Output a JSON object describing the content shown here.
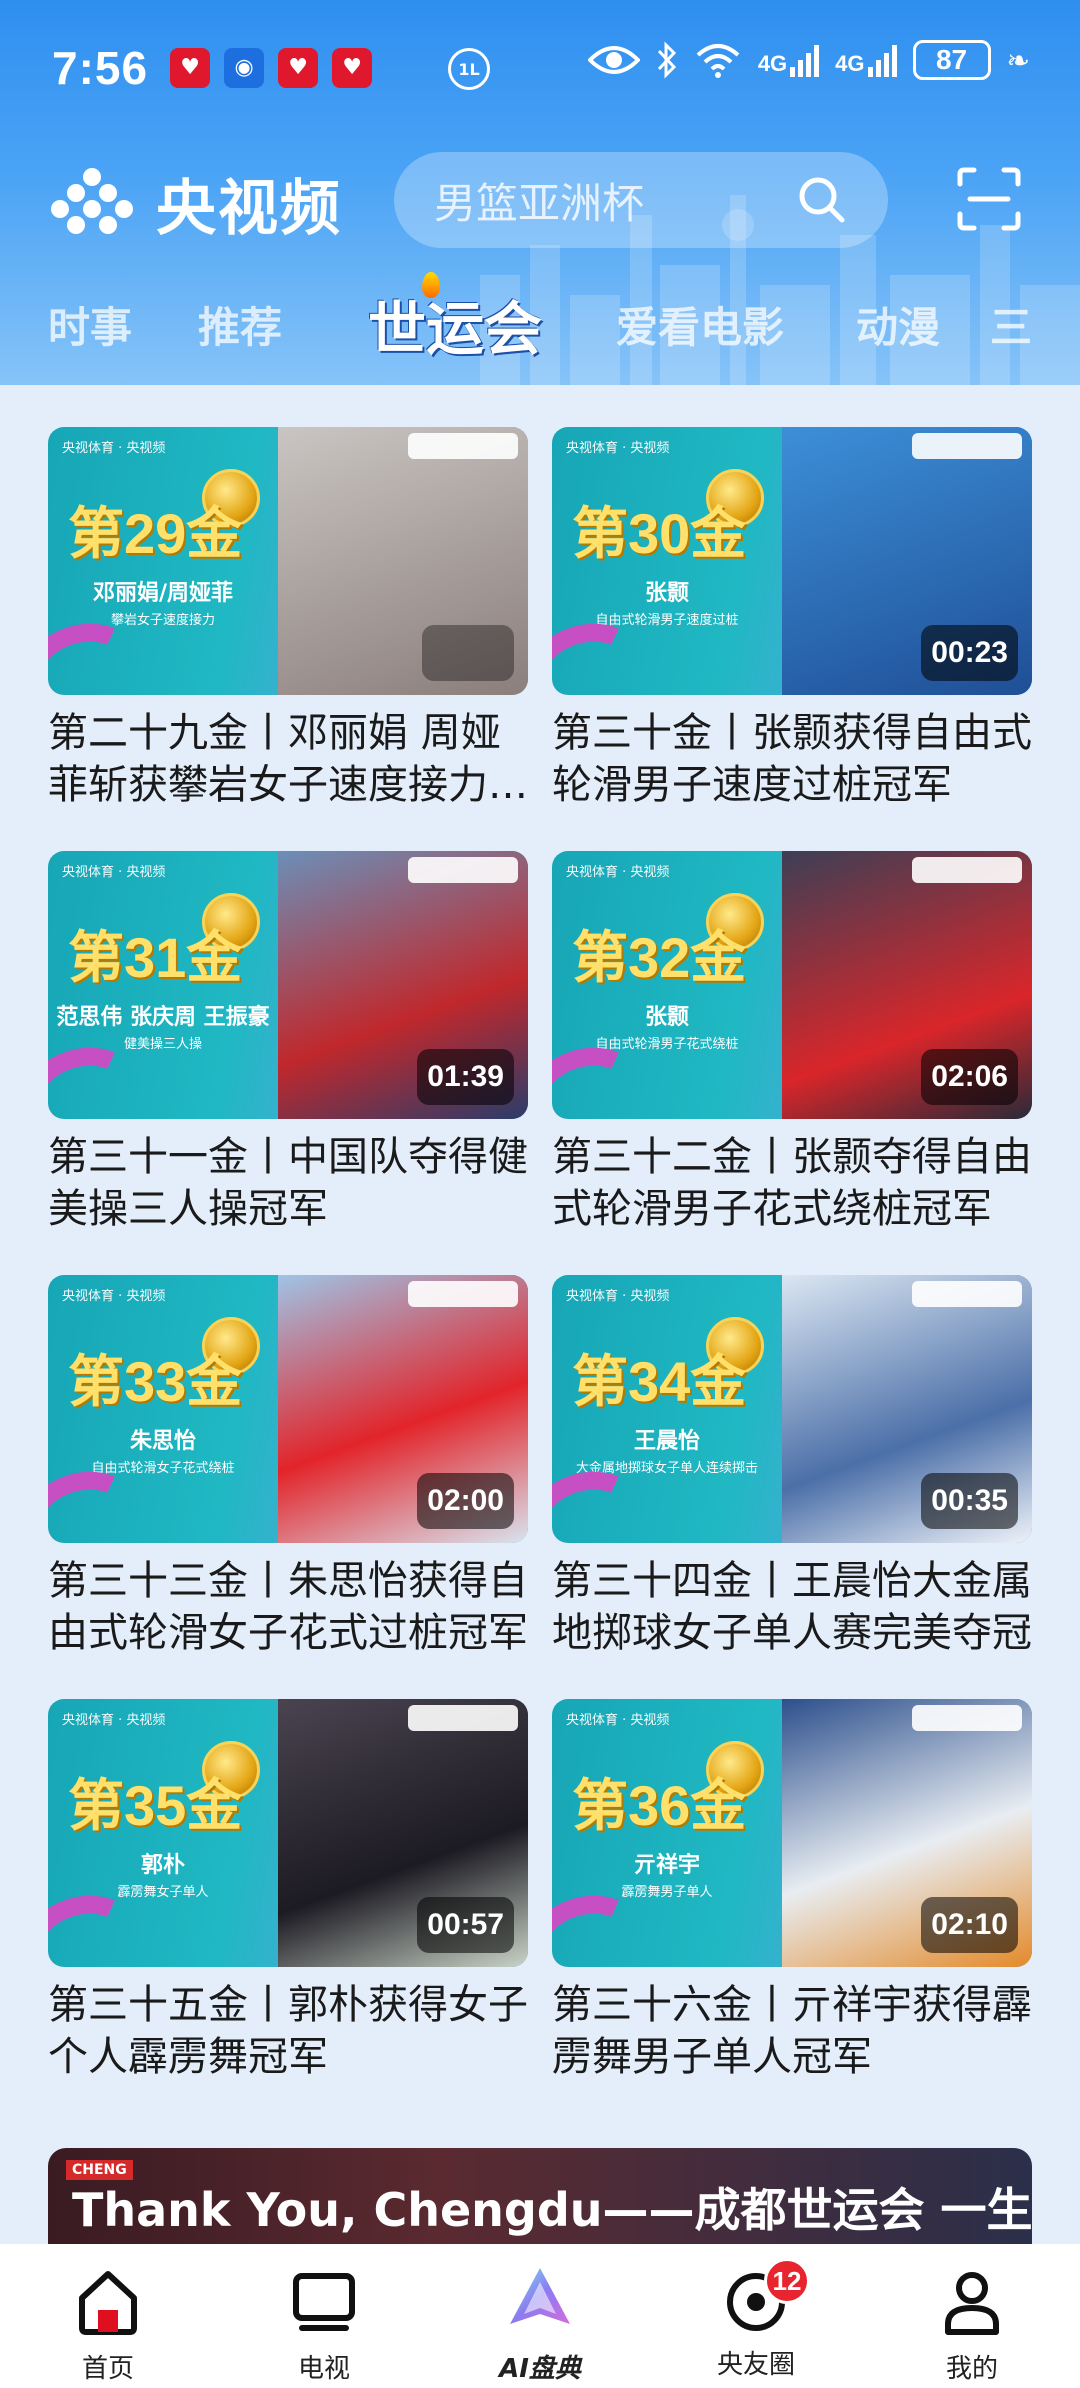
{
  "status_bar": {
    "time": "7:56",
    "notifications": [
      "app-icon",
      "app-icon",
      "app-icon",
      "app-icon"
    ],
    "mid_indicator": "1L",
    "signal_1": "4G",
    "signal_2": "4G",
    "battery": "87"
  },
  "app_bar": {
    "app_name": "央视频",
    "search_placeholder": "男篮亚洲杯"
  },
  "tabs": [
    {
      "label": "时事"
    },
    {
      "label": "推荐"
    },
    {
      "label": "世运会",
      "active": true
    },
    {
      "label": "爱看电影"
    },
    {
      "label": "动漫"
    },
    {
      "label": "三"
    }
  ],
  "videos": [
    {
      "gold": "第29金",
      "athlete": "邓丽娟/周娅菲",
      "event": "攀岩女子速度接力",
      "duration": "",
      "title": "第二十九金丨邓丽娟 周娅菲斩获攀岩女子速度接力冠军"
    },
    {
      "gold": "第30金",
      "athlete": "张颢",
      "event": "自由式轮滑男子速度过桩",
      "duration": "00:23",
      "title": "第三十金丨张颢获得自由式轮滑男子速度过桩冠军"
    },
    {
      "gold": "第31金",
      "athlete": "范思伟 张庆周 王振豪",
      "event": "健美操三人操",
      "duration": "01:39",
      "title": "第三十一金丨中国队夺得健美操三人操冠军"
    },
    {
      "gold": "第32金",
      "athlete": "张颢",
      "event": "自由式轮滑男子花式绕桩",
      "duration": "02:06",
      "title": "第三十二金丨张颢夺得自由式轮滑男子花式绕桩冠军"
    },
    {
      "gold": "第33金",
      "athlete": "朱思怡",
      "event": "自由式轮滑女子花式绕桩",
      "duration": "02:00",
      "title": "第三十三金丨朱思怡获得自由式轮滑女子花式过桩冠军"
    },
    {
      "gold": "第34金",
      "athlete": "王晨怡",
      "event": "大金属地掷球女子单人连续掷击",
      "duration": "00:35",
      "title": "第三十四金丨王晨怡大金属地掷球女子单人赛完美夺冠"
    },
    {
      "gold": "第35金",
      "athlete": "郭朴",
      "event": "霹雳舞女子单人",
      "duration": "00:57",
      "title": "第三十五金丨郭朴获得女子个人霹雳舞冠军"
    },
    {
      "gold": "第36金",
      "athlete": "亓祥宇",
      "event": "霹雳舞男子单人",
      "duration": "02:10",
      "title": "第三十六金丨亓祥宇获得霹雳舞男子单人冠军"
    }
  ],
  "thumb_brand": "央视体育 · 央视频",
  "banner": {
    "tag": "CHENG",
    "text": "Thank You, Chengdu——成都世运会 一生难忘的回忆!"
  },
  "bottom_nav": [
    {
      "label": "首页",
      "icon": "home-icon"
    },
    {
      "label": "电视",
      "icon": "tv-icon"
    },
    {
      "label": "AI盘典",
      "icon": "ai-icon"
    },
    {
      "label": "央友圈",
      "icon": "circle-icon",
      "badge": "12"
    },
    {
      "label": "我的",
      "icon": "user-icon"
    }
  ],
  "colors": {
    "header_blue": "#2f8ff0",
    "badge_red": "#e8242e",
    "page_bg": "#e4eefb"
  }
}
